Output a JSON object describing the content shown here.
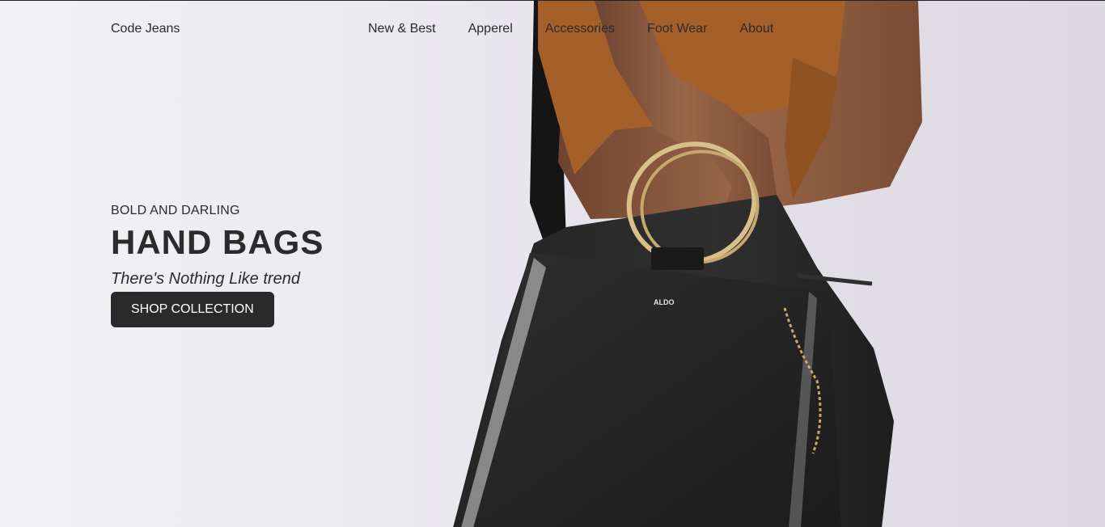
{
  "nav": {
    "brand": "Code Jeans",
    "links": [
      {
        "label": "New & Best"
      },
      {
        "label": "Apperel"
      },
      {
        "label": "Accessories"
      },
      {
        "label": "Foot Wear"
      },
      {
        "label": "About"
      }
    ]
  },
  "hero": {
    "eyebrow": "BOLD AND DARLING",
    "headline": "HAND BAGS",
    "tagline": "There's Nothing Like trend",
    "cta_label": "SHOP COLLECTION",
    "bag_brand": "ALDO"
  },
  "colors": {
    "text": "#2b2b2b",
    "button_bg": "#2a2a2a",
    "button_text": "#ffffff",
    "background": "#eceaf0"
  }
}
